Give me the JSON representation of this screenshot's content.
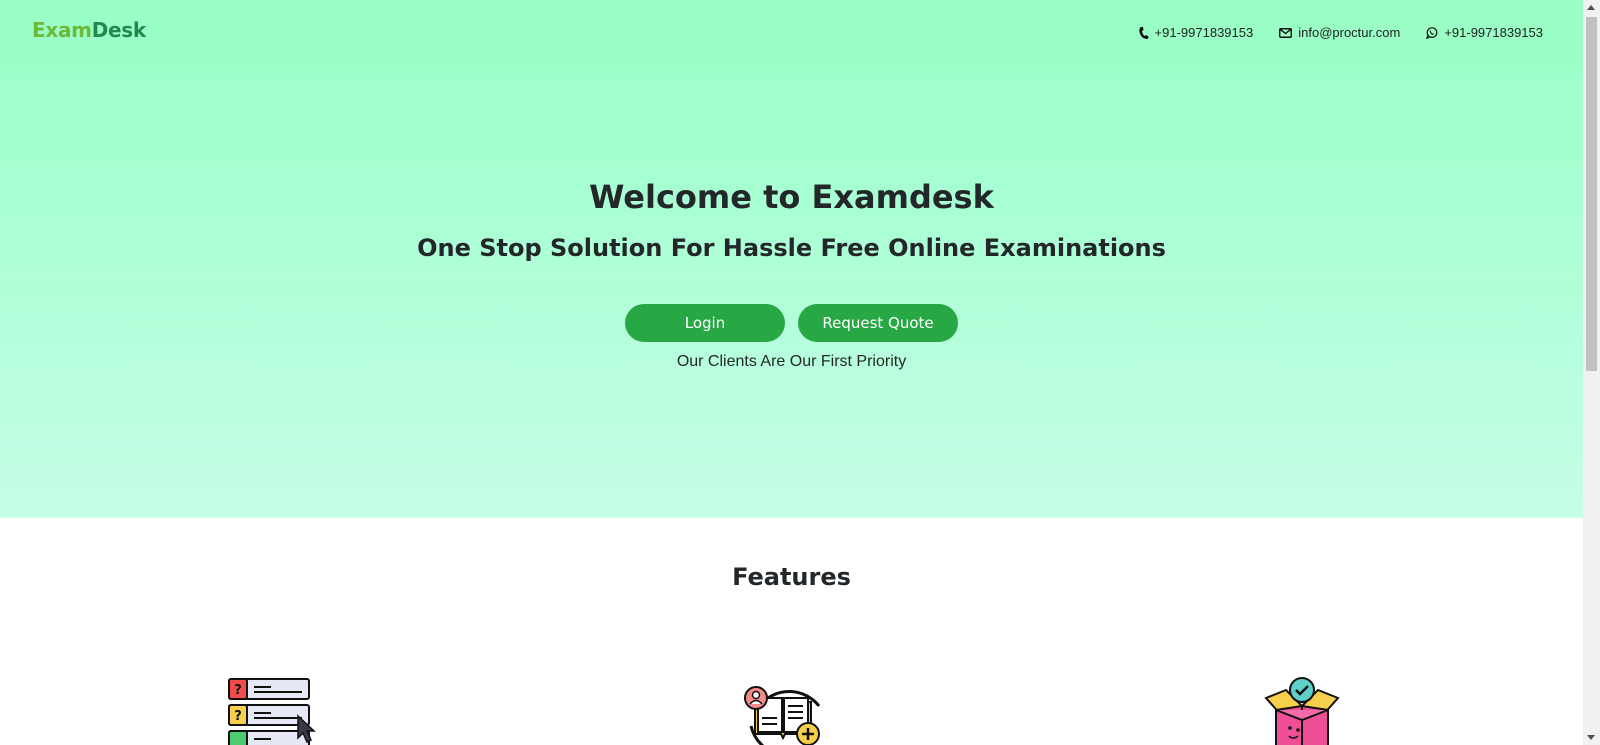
{
  "header": {
    "logo_part1": "Exam",
    "logo_part2": "Desk",
    "phone": "+91-9971839153",
    "email": "info@proctur.com",
    "whatsapp": "+91-9971839153",
    "phone_icon": "phone-icon",
    "email_icon": "envelope-icon",
    "whatsapp_icon": "whatsapp-icon"
  },
  "hero": {
    "title": "Welcome to Examdesk",
    "subtitle": "One Stop Solution For Hassle Free Online Examinations",
    "login_label": "Login",
    "quote_label": "Request Quote",
    "tagline": "Our Clients Are Our First Priority"
  },
  "features": {
    "title": "Features",
    "icons": [
      "question-list-icon",
      "open-book-add-icon",
      "open-box-check-icon"
    ]
  },
  "colors": {
    "hero_bg_top": "#99ffc5",
    "hero_bg_bottom": "#c6fee6",
    "button": "#28a745",
    "logo_light": "#6bb83a",
    "logo_dark": "#1f8a50"
  }
}
